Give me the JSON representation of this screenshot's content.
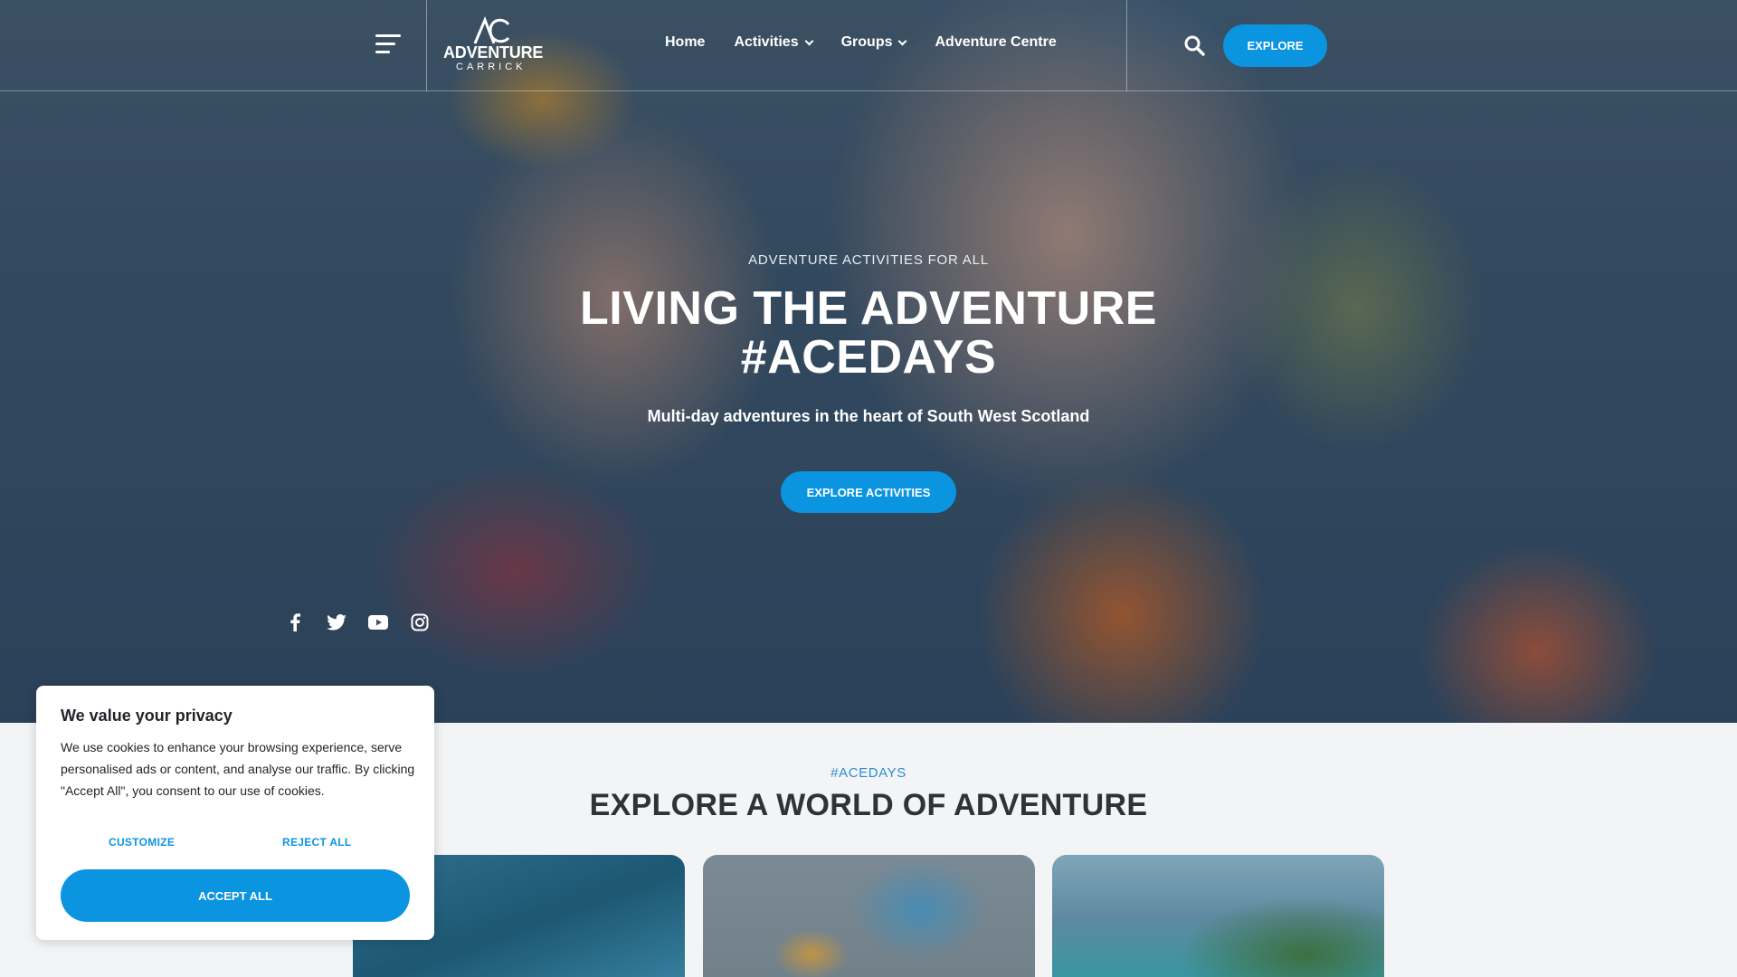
{
  "header": {
    "logo_text": "ADVENTURE",
    "logo_sub": "CARRICK",
    "nav": [
      {
        "label": "Home"
      },
      {
        "label": "Activities"
      },
      {
        "label": "Groups"
      },
      {
        "label": "Adventure Centre"
      }
    ],
    "explore_label": "EXPLORE"
  },
  "hero": {
    "eyebrow": "ADVENTURE ACTIVITIES FOR ALL",
    "title_line1": "LIVING THE ADVENTURE",
    "title_line2": "#ACEDAYS",
    "subtitle": "Multi-day adventures in the heart of South West Scotland",
    "cta_label": "EXPLORE ACTIVITIES",
    "social": [
      "facebook-icon",
      "twitter-icon",
      "youtube-icon",
      "instagram-icon"
    ]
  },
  "section": {
    "eyebrow": "#ACEDAYS",
    "title": "EXPLORE A WORLD OF ADVENTURE"
  },
  "cookie": {
    "title": "We value your privacy",
    "text": "We use cookies to enhance your browsing experience, serve personalised ads or content, and analyse our traffic. By clicking \"Accept All\", you consent to our use of cookies.",
    "customize_label": "CUSTOMIZE",
    "reject_label": "REJECT ALL",
    "accept_label": "ACCEPT ALL"
  },
  "colors": {
    "accent": "#0b94e0",
    "heading": "#2f3337",
    "section_eyebrow": "#2a8fd0"
  }
}
